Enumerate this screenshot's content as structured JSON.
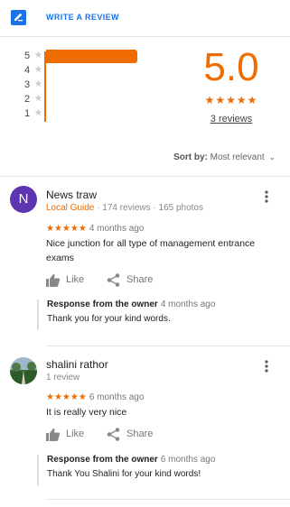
{
  "header": {
    "write_review_label": "WRITE A REVIEW"
  },
  "histogram": {
    "rows": [
      {
        "label": "5",
        "fraction": 1.0
      },
      {
        "label": "4",
        "fraction": 0.0
      },
      {
        "label": "3",
        "fraction": 0.0
      },
      {
        "label": "2",
        "fraction": 0.0
      },
      {
        "label": "1",
        "fraction": 0.0
      }
    ]
  },
  "summary": {
    "rating": "5.0",
    "stars": "★★★★★",
    "count_label": "3 reviews"
  },
  "sort": {
    "label": "Sort by:",
    "value": "Most relevant"
  },
  "reviews": [
    {
      "author": "News traw",
      "avatar_letter": "N",
      "badge": "Local Guide",
      "stats": "· 174 reviews · 165 photos",
      "stars": "★★★★★",
      "ago": "4 months ago",
      "text": "Nice junction for all type of management entrance exams",
      "like_label": "Like",
      "share_label": "Share",
      "owner_label": "Response from the owner",
      "owner_ago": "4 months ago",
      "owner_text": "Thank you for your kind words."
    },
    {
      "author": "shalini rathor",
      "stats": "1 review",
      "stars": "★★★★★",
      "ago": "6 months ago",
      "text": "It is really very nice",
      "like_label": "Like",
      "share_label": "Share",
      "owner_label": "Response from the owner",
      "owner_ago": "6 months ago",
      "owner_text": "Thank You Shalini for your kind words!"
    }
  ],
  "colors": {
    "accent": "#ef6c00",
    "link": "#1a73e8",
    "avatar_bg": "#5e35b1"
  },
  "icons": [
    "write-review-icon",
    "star-icon",
    "more-vert-icon",
    "thumb-up-icon",
    "share-icon",
    "chevron-down-icon"
  ]
}
